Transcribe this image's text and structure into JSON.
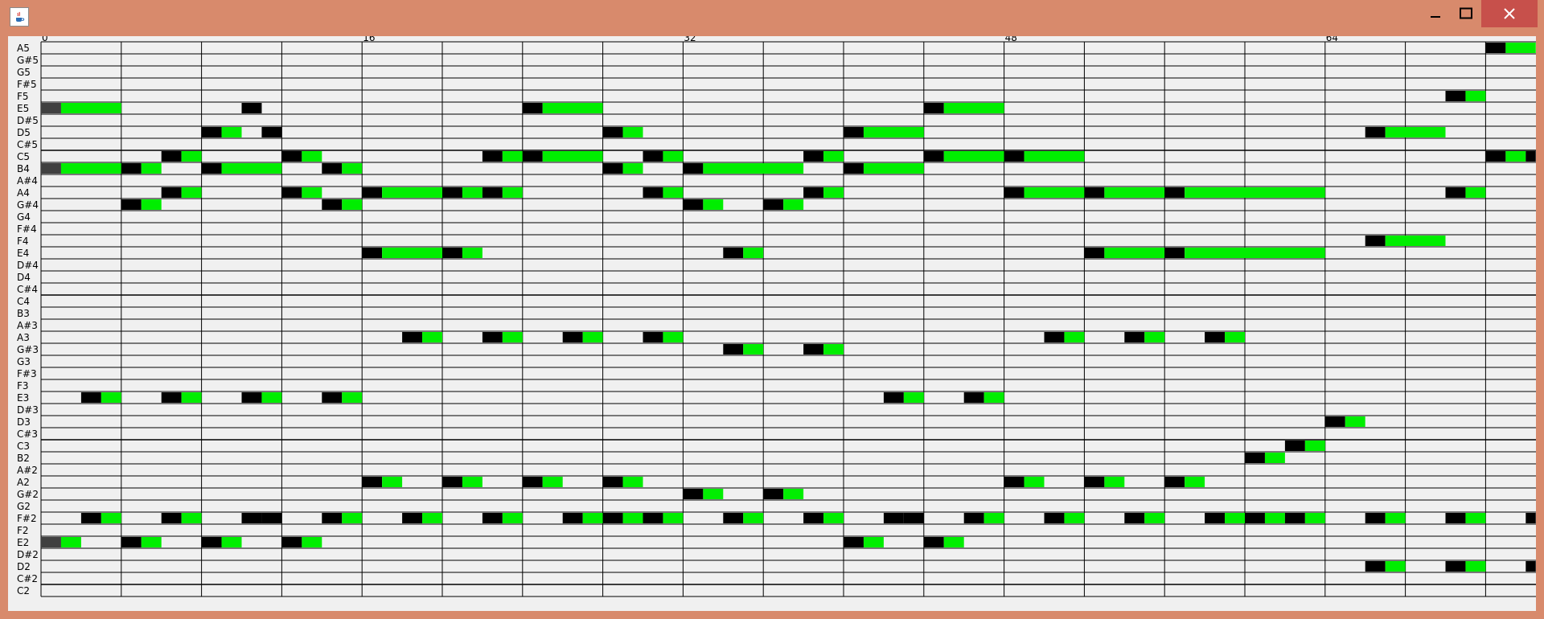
{
  "window": {
    "title": ""
  },
  "icons": {
    "app": "java-cup-icon",
    "minimize": "minimize-icon",
    "maximize": "maximize-icon",
    "close": "close-icon"
  },
  "colors": {
    "titlebar": "#d88a6c",
    "close_button": "#c7504b",
    "grid_bg": "#f0f0f0",
    "note_onset": "#000000",
    "note_sustain": "#00ee00",
    "note_onset_start": "#404040"
  },
  "piano_roll": {
    "pitches": [
      "A5",
      "G#5",
      "G5",
      "F#5",
      "F5",
      "E5",
      "D#5",
      "D5",
      "C#5",
      "C5",
      "B4",
      "A#4",
      "A4",
      "G#4",
      "G4",
      "F#4",
      "F4",
      "E4",
      "D#4",
      "D4",
      "C#4",
      "C4",
      "B3",
      "A#3",
      "A3",
      "G#3",
      "G3",
      "F#3",
      "F3",
      "E3",
      "D#3",
      "D3",
      "C#3",
      "C3",
      "B2",
      "A#2",
      "A2",
      "G#2",
      "G2",
      "F#2",
      "F2",
      "E2",
      "D#2",
      "D2",
      "C#2",
      "C2"
    ],
    "beat_labels": [
      {
        "label": "0",
        "step": 0
      },
      {
        "label": "16",
        "step": 16
      },
      {
        "label": "32",
        "step": 32
      },
      {
        "label": "48",
        "step": 48
      },
      {
        "label": "64",
        "step": 64
      }
    ],
    "total_steps": 74.5,
    "notes": [
      {
        "pitch": "A5",
        "start": 72,
        "len": 2.5
      },
      {
        "pitch": "F5",
        "start": 70,
        "len": 2
      },
      {
        "pitch": "E5",
        "start": 0,
        "len": 4,
        "dark": true
      },
      {
        "pitch": "E5",
        "start": 10,
        "len": 1
      },
      {
        "pitch": "E5",
        "start": 24,
        "len": 4
      },
      {
        "pitch": "E5",
        "start": 44,
        "len": 4
      },
      {
        "pitch": "D5",
        "start": 8,
        "len": 2
      },
      {
        "pitch": "D5",
        "start": 11,
        "len": 1
      },
      {
        "pitch": "D5",
        "start": 28,
        "len": 2
      },
      {
        "pitch": "D5",
        "start": 40,
        "len": 4
      },
      {
        "pitch": "D5",
        "start": 66,
        "len": 4
      },
      {
        "pitch": "C5",
        "start": 6,
        "len": 2
      },
      {
        "pitch": "C5",
        "start": 12,
        "len": 2
      },
      {
        "pitch": "C5",
        "start": 22,
        "len": 2
      },
      {
        "pitch": "C5",
        "start": 24,
        "len": 4
      },
      {
        "pitch": "C5",
        "start": 30,
        "len": 2
      },
      {
        "pitch": "C5",
        "start": 38,
        "len": 2
      },
      {
        "pitch": "C5",
        "start": 44,
        "len": 4
      },
      {
        "pitch": "C5",
        "start": 48,
        "len": 4
      },
      {
        "pitch": "C5",
        "start": 72,
        "len": 2
      },
      {
        "pitch": "C5",
        "start": 74,
        "len": 0.5
      },
      {
        "pitch": "B4",
        "start": 0,
        "len": 4,
        "dark": true
      },
      {
        "pitch": "B4",
        "start": 4,
        "len": 2
      },
      {
        "pitch": "B4",
        "start": 8,
        "len": 4
      },
      {
        "pitch": "B4",
        "start": 14,
        "len": 2
      },
      {
        "pitch": "B4",
        "start": 28,
        "len": 2
      },
      {
        "pitch": "B4",
        "start": 32,
        "len": 6
      },
      {
        "pitch": "B4",
        "start": 40,
        "len": 4
      },
      {
        "pitch": "A4",
        "start": 6,
        "len": 2
      },
      {
        "pitch": "A4",
        "start": 12,
        "len": 2
      },
      {
        "pitch": "A4",
        "start": 16,
        "len": 4
      },
      {
        "pitch": "A4",
        "start": 20,
        "len": 2
      },
      {
        "pitch": "A4",
        "start": 22,
        "len": 2
      },
      {
        "pitch": "A4",
        "start": 30,
        "len": 2
      },
      {
        "pitch": "A4",
        "start": 38,
        "len": 2
      },
      {
        "pitch": "A4",
        "start": 48,
        "len": 4
      },
      {
        "pitch": "A4",
        "start": 52,
        "len": 4
      },
      {
        "pitch": "A4",
        "start": 56,
        "len": 8
      },
      {
        "pitch": "A4",
        "start": 70,
        "len": 2
      },
      {
        "pitch": "G#4",
        "start": 4,
        "len": 2
      },
      {
        "pitch": "G#4",
        "start": 14,
        "len": 2
      },
      {
        "pitch": "G#4",
        "start": 32,
        "len": 2
      },
      {
        "pitch": "G#4",
        "start": 36,
        "len": 2
      },
      {
        "pitch": "F4",
        "start": 66,
        "len": 4
      },
      {
        "pitch": "E4",
        "start": 16,
        "len": 4
      },
      {
        "pitch": "E4",
        "start": 20,
        "len": 2
      },
      {
        "pitch": "E4",
        "start": 34,
        "len": 2
      },
      {
        "pitch": "E4",
        "start": 52,
        "len": 4
      },
      {
        "pitch": "E4",
        "start": 56,
        "len": 8
      },
      {
        "pitch": "A3",
        "start": 18,
        "len": 2
      },
      {
        "pitch": "A3",
        "start": 22,
        "len": 2
      },
      {
        "pitch": "A3",
        "start": 26,
        "len": 2
      },
      {
        "pitch": "A3",
        "start": 30,
        "len": 2
      },
      {
        "pitch": "A3",
        "start": 50,
        "len": 2
      },
      {
        "pitch": "A3",
        "start": 54,
        "len": 2
      },
      {
        "pitch": "A3",
        "start": 58,
        "len": 2
      },
      {
        "pitch": "G#3",
        "start": 34,
        "len": 2
      },
      {
        "pitch": "G#3",
        "start": 38,
        "len": 2
      },
      {
        "pitch": "E3",
        "start": 2,
        "len": 2
      },
      {
        "pitch": "E3",
        "start": 6,
        "len": 2
      },
      {
        "pitch": "E3",
        "start": 10,
        "len": 2
      },
      {
        "pitch": "E3",
        "start": 14,
        "len": 2
      },
      {
        "pitch": "E3",
        "start": 42,
        "len": 2
      },
      {
        "pitch": "E3",
        "start": 46,
        "len": 2
      },
      {
        "pitch": "D3",
        "start": 64,
        "len": 2
      },
      {
        "pitch": "C3",
        "start": 62,
        "len": 2
      },
      {
        "pitch": "B2",
        "start": 60,
        "len": 2
      },
      {
        "pitch": "A2",
        "start": 16,
        "len": 2
      },
      {
        "pitch": "A2",
        "start": 20,
        "len": 2
      },
      {
        "pitch": "A2",
        "start": 24,
        "len": 2
      },
      {
        "pitch": "A2",
        "start": 28,
        "len": 2
      },
      {
        "pitch": "A2",
        "start": 48,
        "len": 2
      },
      {
        "pitch": "A2",
        "start": 52,
        "len": 2
      },
      {
        "pitch": "A2",
        "start": 56,
        "len": 2
      },
      {
        "pitch": "G#2",
        "start": 32,
        "len": 2
      },
      {
        "pitch": "G#2",
        "start": 36,
        "len": 2
      },
      {
        "pitch": "F#2",
        "start": 2,
        "len": 2
      },
      {
        "pitch": "F#2",
        "start": 6,
        "len": 2
      },
      {
        "pitch": "F#2",
        "start": 10,
        "len": 1
      },
      {
        "pitch": "F#2",
        "start": 11,
        "len": 1
      },
      {
        "pitch": "F#2",
        "start": 14,
        "len": 2
      },
      {
        "pitch": "F#2",
        "start": 18,
        "len": 2
      },
      {
        "pitch": "F#2",
        "start": 22,
        "len": 2
      },
      {
        "pitch": "F#2",
        "start": 26,
        "len": 2
      },
      {
        "pitch": "F#2",
        "start": 28,
        "len": 2
      },
      {
        "pitch": "F#2",
        "start": 30,
        "len": 2
      },
      {
        "pitch": "F#2",
        "start": 34,
        "len": 2
      },
      {
        "pitch": "F#2",
        "start": 38,
        "len": 2
      },
      {
        "pitch": "F#2",
        "start": 42,
        "len": 1
      },
      {
        "pitch": "F#2",
        "start": 43,
        "len": 1
      },
      {
        "pitch": "F#2",
        "start": 46,
        "len": 2
      },
      {
        "pitch": "F#2",
        "start": 50,
        "len": 2
      },
      {
        "pitch": "F#2",
        "start": 54,
        "len": 2
      },
      {
        "pitch": "F#2",
        "start": 58,
        "len": 2
      },
      {
        "pitch": "F#2",
        "start": 60,
        "len": 2
      },
      {
        "pitch": "F#2",
        "start": 62,
        "len": 2
      },
      {
        "pitch": "F#2",
        "start": 66,
        "len": 2
      },
      {
        "pitch": "F#2",
        "start": 70,
        "len": 2
      },
      {
        "pitch": "F#2",
        "start": 74,
        "len": 0.5
      },
      {
        "pitch": "E2",
        "start": 0,
        "len": 2,
        "dark": true
      },
      {
        "pitch": "E2",
        "start": 4,
        "len": 2
      },
      {
        "pitch": "E2",
        "start": 8,
        "len": 2
      },
      {
        "pitch": "E2",
        "start": 12,
        "len": 2
      },
      {
        "pitch": "E2",
        "start": 40,
        "len": 2
      },
      {
        "pitch": "E2",
        "start": 44,
        "len": 2
      },
      {
        "pitch": "D2",
        "start": 66,
        "len": 2
      },
      {
        "pitch": "D2",
        "start": 70,
        "len": 2
      },
      {
        "pitch": "D2",
        "start": 74,
        "len": 0.5
      }
    ]
  }
}
